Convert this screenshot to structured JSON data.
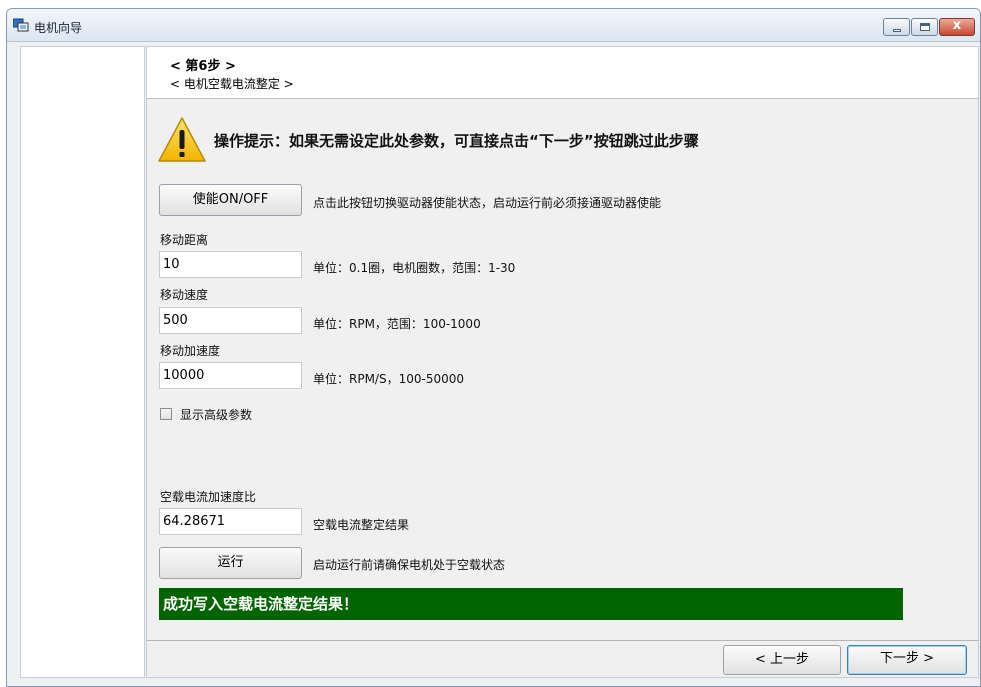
{
  "window": {
    "title": "电机向导",
    "close_glyph": "x"
  },
  "header": {
    "step": "< 第6步 >",
    "subtitle": "< 电机空载电流整定 >"
  },
  "warning": {
    "icon": "warning-triangle-icon",
    "text": "操作提示：如果无需设定此处参数，可直接点击“下一步”按钮跳过此步骤"
  },
  "enable": {
    "button_label": "使能ON/OFF",
    "hint": "点击此按钮切换驱动器使能状态，启动运行前必须接通驱动器使能"
  },
  "fields": [
    {
      "label": "移动距离",
      "value": "10",
      "hint": "单位：0.1圈，电机圈数，范围：1-30"
    },
    {
      "label": "移动速度",
      "value": "500",
      "hint": "单位：RPM，范围：100-1000"
    },
    {
      "label": "移动加速度",
      "value": "10000",
      "hint": "单位：RPM/S，100-50000"
    }
  ],
  "advanced": {
    "label": "显示高级参数",
    "checked": false
  },
  "result": {
    "label": "空载电流加速度比",
    "value": "64.28671",
    "hint": "空载电流整定结果"
  },
  "run": {
    "button_label": "运行",
    "hint": "启动运行前请确保电机处于空载状态"
  },
  "status": {
    "message": "成功写入空载电流整定结果！",
    "color": "#006400"
  },
  "nav": {
    "prev_label": "< 上一步",
    "next_label": "下一步 >"
  }
}
